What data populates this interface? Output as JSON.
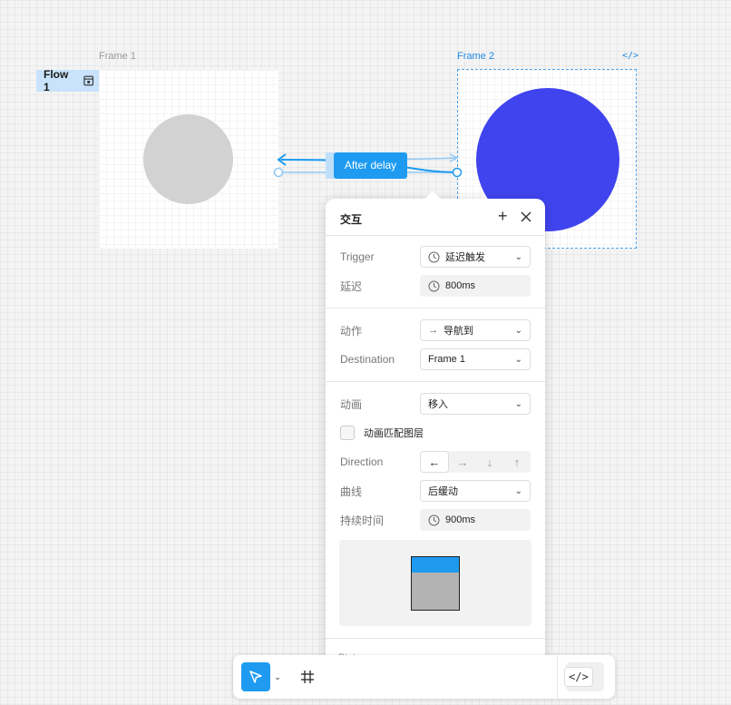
{
  "canvas": {
    "frame1": {
      "label": "Frame 1"
    },
    "frame2": {
      "label": "Frame 2"
    },
    "flow_tag": {
      "label": "Flow 1"
    },
    "connection": {
      "label": "After delay"
    },
    "colors": {
      "accent": "#1e9bf0",
      "circle_gray": "#d2d2d2",
      "circle_blue": "#4044ee"
    }
  },
  "panel": {
    "title": "交互",
    "trigger": {
      "label": "Trigger",
      "value": "延迟触发",
      "icon": "timer-icon"
    },
    "delay": {
      "label": "延迟",
      "value": "800ms",
      "icon": "timer-icon"
    },
    "action": {
      "label": "动作",
      "value": "导航到",
      "icon": "arrow-right-icon"
    },
    "destination": {
      "label": "Destination",
      "value": "Frame 1"
    },
    "animation": {
      "label": "动画",
      "value": "移入"
    },
    "smart_animate": {
      "label": "动画匹配图层",
      "checked": false
    },
    "direction": {
      "label": "Direction",
      "options": [
        "←",
        "→",
        "↓",
        "↑"
      ],
      "selected": "←"
    },
    "curve": {
      "label": "曲线",
      "value": "后缓动"
    },
    "duration": {
      "label": "持续时间",
      "value": "900ms",
      "icon": "timer-icon"
    },
    "state": {
      "label": "State"
    }
  }
}
